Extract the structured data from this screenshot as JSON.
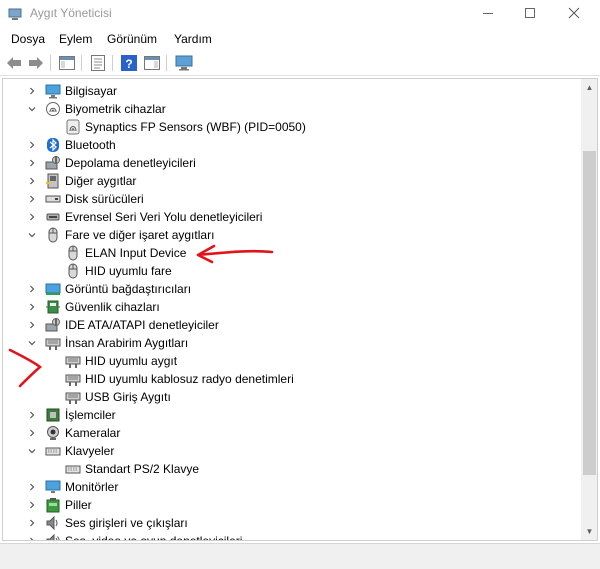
{
  "window": {
    "title": "Aygıt Yöneticisi"
  },
  "menu": [
    "Dosya",
    "Eylem",
    "Görünüm",
    "Yardım"
  ],
  "tree": [
    {
      "label": "Bilgisayar",
      "icon": "computer-icon",
      "level": 0,
      "state": "collapsed"
    },
    {
      "label": "Biyometrik cihazlar",
      "icon": "biometric-icon",
      "level": 0,
      "state": "expanded"
    },
    {
      "label": "Synaptics FP Sensors (WBF) (PID=0050)",
      "icon": "fingerprint-icon",
      "level": 1,
      "state": "leaf"
    },
    {
      "label": "Bluetooth",
      "icon": "bluetooth-icon",
      "level": 0,
      "state": "collapsed"
    },
    {
      "label": "Depolama denetleyicileri",
      "icon": "storage-controller-icon",
      "level": 0,
      "state": "collapsed"
    },
    {
      "label": "Diğer aygıtlar",
      "icon": "other-devices-icon",
      "level": 0,
      "state": "collapsed"
    },
    {
      "label": "Disk sürücüleri",
      "icon": "disk-drive-icon",
      "level": 0,
      "state": "collapsed"
    },
    {
      "label": "Evrensel Seri Veri Yolu denetleyicileri",
      "icon": "usb-controller-icon",
      "level": 0,
      "state": "collapsed"
    },
    {
      "label": "Fare ve diğer işaret aygıtları",
      "icon": "mouse-icon",
      "level": 0,
      "state": "expanded"
    },
    {
      "label": "ELAN Input Device",
      "icon": "mouse-icon",
      "level": 1,
      "state": "leaf"
    },
    {
      "label": "HID uyumlu fare",
      "icon": "mouse-icon",
      "level": 1,
      "state": "leaf"
    },
    {
      "label": "Görüntü bağdaştırıcıları",
      "icon": "display-adapter-icon",
      "level": 0,
      "state": "collapsed"
    },
    {
      "label": "Güvenlik cihazları",
      "icon": "security-device-icon",
      "level": 0,
      "state": "collapsed"
    },
    {
      "label": "IDE ATA/ATAPI denetleyiciler",
      "icon": "ide-controller-icon",
      "level": 0,
      "state": "collapsed"
    },
    {
      "label": "İnsan Arabirim Aygıtları",
      "icon": "hid-icon",
      "level": 0,
      "state": "expanded"
    },
    {
      "label": "HID uyumlu aygıt",
      "icon": "hid-icon",
      "level": 1,
      "state": "leaf"
    },
    {
      "label": "HID uyumlu kablosuz radyo denetimleri",
      "icon": "hid-icon",
      "level": 1,
      "state": "leaf"
    },
    {
      "label": "USB Giriş Aygıtı",
      "icon": "hid-icon",
      "level": 1,
      "state": "leaf"
    },
    {
      "label": "İşlemciler",
      "icon": "processor-icon",
      "level": 0,
      "state": "collapsed"
    },
    {
      "label": "Kameralar",
      "icon": "camera-icon",
      "level": 0,
      "state": "collapsed"
    },
    {
      "label": "Klavyeler",
      "icon": "keyboard-icon",
      "level": 0,
      "state": "expanded"
    },
    {
      "label": "Standart PS/2 Klavye",
      "icon": "keyboard-icon",
      "level": 1,
      "state": "leaf"
    },
    {
      "label": "Monitörler",
      "icon": "monitor-icon",
      "level": 0,
      "state": "collapsed"
    },
    {
      "label": "Piller",
      "icon": "battery-icon",
      "level": 0,
      "state": "collapsed"
    },
    {
      "label": "Ses girişleri ve çıkışları",
      "icon": "audio-io-icon",
      "level": 0,
      "state": "collapsed"
    },
    {
      "label": "Ses, video ve oyun denetleyicileri",
      "icon": "sound-controller-icon",
      "level": 0,
      "state": "collapsed"
    }
  ],
  "colors": {
    "annotation": "#e0151b",
    "accent": "#0a6ed1"
  }
}
